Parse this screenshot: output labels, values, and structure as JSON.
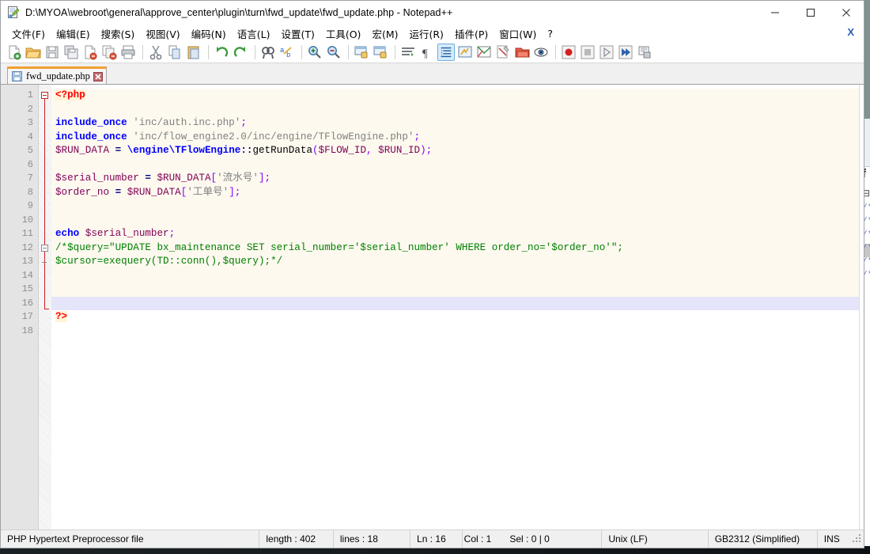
{
  "window": {
    "title": "D:\\MYOA\\webroot\\general\\approve_center\\plugin\\turn\\fwd_update\\fwd_update.php - Notepad++",
    "icon": "notepad-plus-plus-icon",
    "controls": {
      "minimize": "minimize-icon",
      "maximize": "maximize-icon",
      "close": "close-icon"
    }
  },
  "menu": {
    "items": [
      {
        "label": "文件(F)",
        "accel": "F"
      },
      {
        "label": "编辑(E)",
        "accel": "E"
      },
      {
        "label": "搜索(S)",
        "accel": "S"
      },
      {
        "label": "视图(V)",
        "accel": "V"
      },
      {
        "label": "编码(N)",
        "accel": "N"
      },
      {
        "label": "语言(L)",
        "accel": "L"
      },
      {
        "label": "设置(T)",
        "accel": "T"
      },
      {
        "label": "工具(O)",
        "accel": "O"
      },
      {
        "label": "宏(M)",
        "accel": "M"
      },
      {
        "label": "运行(R)",
        "accel": "R"
      },
      {
        "label": "插件(P)",
        "accel": "P"
      },
      {
        "label": "窗口(W)",
        "accel": "W"
      },
      {
        "label": "?",
        "accel": ""
      }
    ],
    "close_document": "X"
  },
  "toolbar": {
    "buttons": [
      "new-file-icon",
      "open-file-icon",
      "save-icon",
      "save-all-icon",
      "close-file-icon",
      "close-all-icon",
      "print-icon",
      "SEP",
      "cut-icon",
      "copy-icon",
      "paste-icon",
      "SEP",
      "undo-icon",
      "redo-icon",
      "SEP",
      "find-icon",
      "replace-icon",
      "SEP",
      "zoom-in-icon",
      "zoom-out-icon",
      "SEP",
      "sync-vertical-scroll-icon",
      "sync-horizontal-scroll-icon",
      "SEP",
      "word-wrap-icon",
      "show-all-characters-icon",
      "indent-guide-icon",
      "user-defined-language-icon",
      "document-map-icon",
      "function-list-icon",
      "folder-as-workspace-icon",
      "monitor-icon",
      "SEP",
      "record-macro-icon",
      "stop-record-icon",
      "play-macro-icon",
      "run-macro-multiple-icon",
      "save-macro-icon"
    ]
  },
  "tabs": [
    {
      "label": "fwd_update.php",
      "icon": "saved-file-icon",
      "close": "close-tab-icon",
      "active": true
    }
  ],
  "editor": {
    "total_lines": 18,
    "current_line": 16,
    "lines": [
      {
        "n": 1,
        "bg": "cream",
        "tokens": [
          {
            "t": "tag",
            "v": "<?php"
          }
        ]
      },
      {
        "n": 2,
        "bg": "cream",
        "tokens": []
      },
      {
        "n": 3,
        "bg": "cream",
        "tokens": [
          {
            "t": "kw",
            "v": "include_once"
          },
          {
            "t": "plain",
            "v": " "
          },
          {
            "t": "str",
            "v": "'inc/auth.inc.php'"
          },
          {
            "t": "punct",
            "v": ";"
          }
        ]
      },
      {
        "n": 4,
        "bg": "cream",
        "tokens": [
          {
            "t": "kw",
            "v": "include_once"
          },
          {
            "t": "plain",
            "v": " "
          },
          {
            "t": "str",
            "v": "'inc/flow_engine2.0/inc/engine/TFlowEngine.php'"
          },
          {
            "t": "punct",
            "v": ";"
          }
        ]
      },
      {
        "n": 5,
        "bg": "cream",
        "tokens": [
          {
            "t": "var",
            "v": "$RUN_DATA"
          },
          {
            "t": "plain",
            "v": " "
          },
          {
            "t": "op",
            "v": "="
          },
          {
            "t": "plain",
            "v": " "
          },
          {
            "t": "kw2",
            "v": "\\engine\\TFlowEngine"
          },
          {
            "t": "op",
            "v": "::"
          },
          {
            "t": "func",
            "v": "getRunData"
          },
          {
            "t": "punct",
            "v": "("
          },
          {
            "t": "var",
            "v": "$FLOW_ID"
          },
          {
            "t": "punct",
            "v": ","
          },
          {
            "t": "plain",
            "v": " "
          },
          {
            "t": "var",
            "v": "$RUN_ID"
          },
          {
            "t": "punct",
            "v": ");"
          }
        ]
      },
      {
        "n": 6,
        "bg": "cream",
        "tokens": []
      },
      {
        "n": 7,
        "bg": "cream",
        "tokens": [
          {
            "t": "var",
            "v": "$serial_number"
          },
          {
            "t": "plain",
            "v": " "
          },
          {
            "t": "op",
            "v": "="
          },
          {
            "t": "plain",
            "v": " "
          },
          {
            "t": "var",
            "v": "$RUN_DATA"
          },
          {
            "t": "punct",
            "v": "["
          },
          {
            "t": "str",
            "v": "'流水号'"
          },
          {
            "t": "punct",
            "v": "];"
          }
        ]
      },
      {
        "n": 8,
        "bg": "cream",
        "tokens": [
          {
            "t": "var",
            "v": "$order_no"
          },
          {
            "t": "plain",
            "v": " "
          },
          {
            "t": "op",
            "v": "="
          },
          {
            "t": "plain",
            "v": " "
          },
          {
            "t": "var",
            "v": "$RUN_DATA"
          },
          {
            "t": "punct",
            "v": "["
          },
          {
            "t": "str",
            "v": "'工单号'"
          },
          {
            "t": "punct",
            "v": "];"
          }
        ]
      },
      {
        "n": 9,
        "bg": "cream",
        "tokens": []
      },
      {
        "n": 10,
        "bg": "cream",
        "tokens": []
      },
      {
        "n": 11,
        "bg": "cream",
        "tokens": [
          {
            "t": "kw",
            "v": "echo"
          },
          {
            "t": "plain",
            "v": " "
          },
          {
            "t": "var",
            "v": "$serial_number"
          },
          {
            "t": "punct",
            "v": ";"
          }
        ]
      },
      {
        "n": 12,
        "bg": "cream",
        "tokens": [
          {
            "t": "comment",
            "v": "/*$query=\"UPDATE bx_maintenance SET serial_number='$serial_number' WHERE order_no='$order_no'\";"
          }
        ]
      },
      {
        "n": 13,
        "bg": "cream",
        "tokens": [
          {
            "t": "comment",
            "v": "$cursor=exequery(TD::conn(),$query);*/"
          }
        ]
      },
      {
        "n": 14,
        "bg": "cream",
        "tokens": []
      },
      {
        "n": 15,
        "bg": "cream",
        "tokens": []
      },
      {
        "n": 16,
        "bg": "cur",
        "tokens": []
      },
      {
        "n": 17,
        "bg": "white",
        "tokens": [
          {
            "t": "tag",
            "v": "?>"
          }
        ]
      },
      {
        "n": 18,
        "bg": "white",
        "tokens": []
      }
    ]
  },
  "statusbar": {
    "file_type": "PHP Hypertext Preprocessor file",
    "length_label": "length : 402",
    "lines_label": "lines : 18",
    "ln": "Ln : 16",
    "col": "Col : 1",
    "sel": "Sel : 0 | 0",
    "eol": "Unix (LF)",
    "encoding": "GB2312 (Simplified)",
    "insert_mode": "INS"
  },
  "colors": {
    "accent_tab": "#f0a030",
    "keyword": "#0000ff",
    "string": "#808080",
    "variable": "#7f0055",
    "comment": "#008000",
    "php_tag": "#ff0000",
    "current_line_bg": "#e4e4fa",
    "doc_bg": "#fdf9ef"
  }
}
